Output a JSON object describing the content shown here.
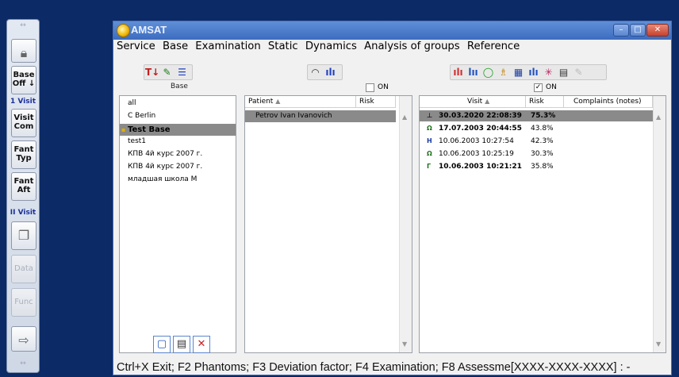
{
  "leftbar": {
    "top_grip": "↔",
    "lock_icon": "lock-icon",
    "base_off_label": "Base\nOff ↓",
    "visit1_label": "1 Visit",
    "visit_com_label": "Visit\nCom",
    "fant_typ_label": "Fant\nTyp",
    "fant_aft_label": "Fant\nAft",
    "visit2_label": "II Visit",
    "data_label": "Data",
    "func_label": "Func",
    "bottom_grip": "↔"
  },
  "window": {
    "title": "AMSAT",
    "min": "–",
    "max": "□",
    "close": "✕"
  },
  "menu": [
    "Service",
    "Base",
    "Examination",
    "Static",
    "Dynamics",
    "Analysis of groups",
    "Reference"
  ],
  "base_panel": {
    "label": "Base",
    "items": [
      "all",
      "C Berlin",
      "Test Base",
      "test1",
      "КПВ 4й курс 2007 г.",
      "КПВ 4й курс 2007 г.",
      "младшая школа М"
    ],
    "selected_index": 2
  },
  "patient_panel": {
    "on_label": "ON",
    "col_patient": "Patient",
    "col_risk": "Risk",
    "rows": [
      {
        "name": "Petrov Ivan Ivanovich",
        "risk": ""
      }
    ]
  },
  "visit_panel": {
    "on_label": "ON",
    "col_visit": "Visit",
    "col_risk": "Risk",
    "col_complaints": "Complaints (notes)",
    "rows": [
      {
        "icon": "⊥",
        "date": "30.03.2020 22:08:39",
        "risk": "75.3%",
        "bold": true
      },
      {
        "icon": "Ω",
        "date": "17.07.2003 20:44:55",
        "risk": "43.8%",
        "bold": true
      },
      {
        "icon": "Н",
        "date": "10.06.2003 10:27:54",
        "risk": "42.3%",
        "bold": false
      },
      {
        "icon": "Ω",
        "date": "10.06.2003 10:25:19",
        "risk": "30.3%",
        "bold": false
      },
      {
        "icon": "Г",
        "date": "10.06.2003 10:21:21",
        "risk": "35.8%",
        "bold": true
      }
    ]
  },
  "statusbar": "Ctrl+X Exit; F2 Phantoms; F3 Deviation factor; F4 Examination; F8 Assessme[XXXX-XXXX-XXXX] : -"
}
